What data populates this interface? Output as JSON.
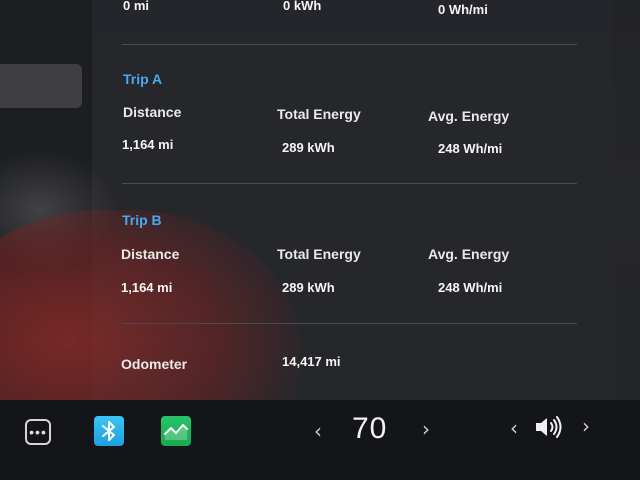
{
  "top_row": {
    "distance": "0 mi",
    "total_energy": "0 kWh",
    "avg_energy": "0 Wh/mi"
  },
  "trip_a": {
    "title": "Trip A",
    "distance_label": "Distance",
    "total_energy_label": "Total Energy",
    "avg_energy_label": "Avg. Energy",
    "distance": "1,164 mi",
    "total_energy": "289 kWh",
    "avg_energy": "248 Wh/mi"
  },
  "trip_b": {
    "title": "Trip B",
    "distance_label": "Distance",
    "total_energy_label": "Total Energy",
    "avg_energy_label": "Avg. Energy",
    "distance": "1,164 mi",
    "total_energy": "289 kWh",
    "avg_energy": "248 Wh/mi"
  },
  "odometer": {
    "label": "Odometer",
    "value": "14,417 mi"
  },
  "dock": {
    "more_icon": "more-dots-icon",
    "bluetooth_icon": "bluetooth-icon",
    "energy_icon": "energy-graph-icon",
    "temp_decrease": "‹",
    "temperature": "70",
    "temp_increase": "›",
    "volume_decrease": "‹",
    "volume_icon": "speaker-volume-icon",
    "volume_increase": "›"
  },
  "colors": {
    "accent": "#48a8f0",
    "bluetooth": "#2bb3ef",
    "energy": "#1fb65d"
  }
}
